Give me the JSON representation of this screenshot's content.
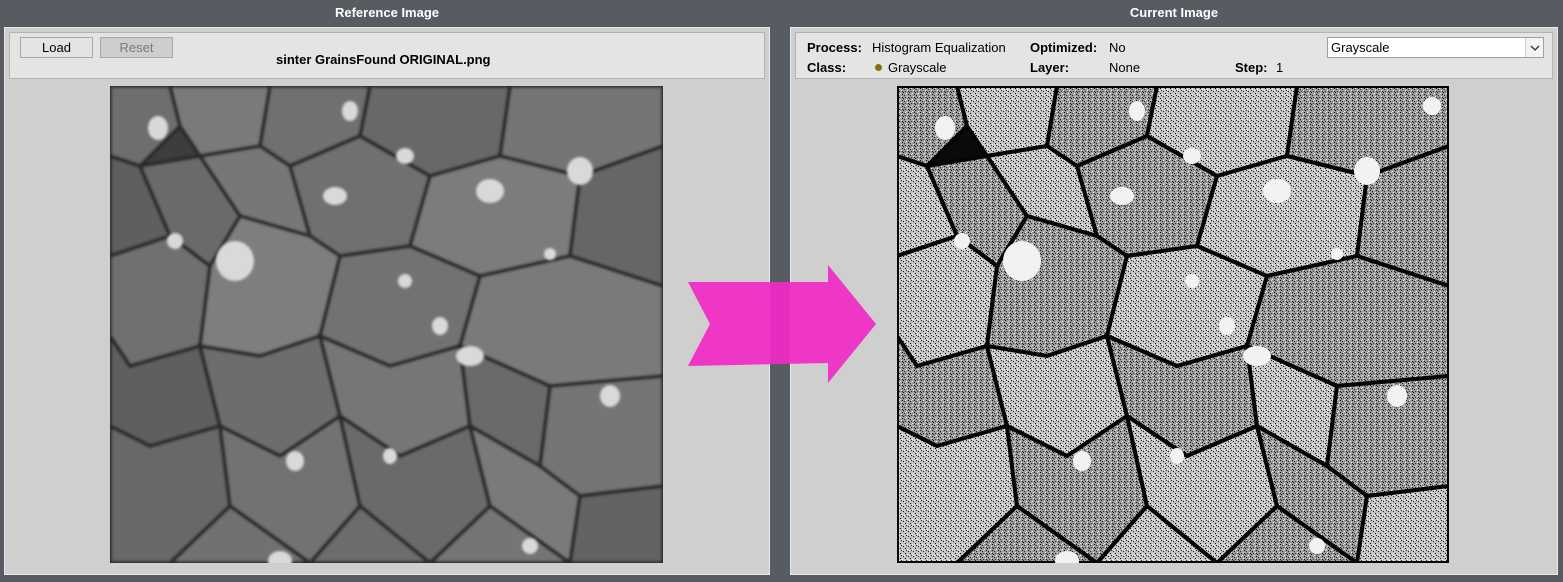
{
  "reference": {
    "title": "Reference Image",
    "load_label": "Load",
    "reset_label": "Reset",
    "filename": "sinter GrainsFound ORIGINAL.png"
  },
  "current": {
    "title": "Current Image",
    "process_label": "Process:",
    "process_value": "Histogram Equalization",
    "optimized_label": "Optimized:",
    "optimized_value": "No",
    "class_label": "Class:",
    "class_value": "Grayscale",
    "layer_label": "Layer:",
    "layer_value": "None",
    "step_label": "Step:",
    "step_value": "1",
    "mode_select": "Grayscale"
  },
  "colors": {
    "background": "#575c63",
    "arrow": "#f02ac6",
    "class_dot": "#8a6f10"
  },
  "icons": [
    "chevron-down-icon",
    "arrow-right-icon"
  ]
}
